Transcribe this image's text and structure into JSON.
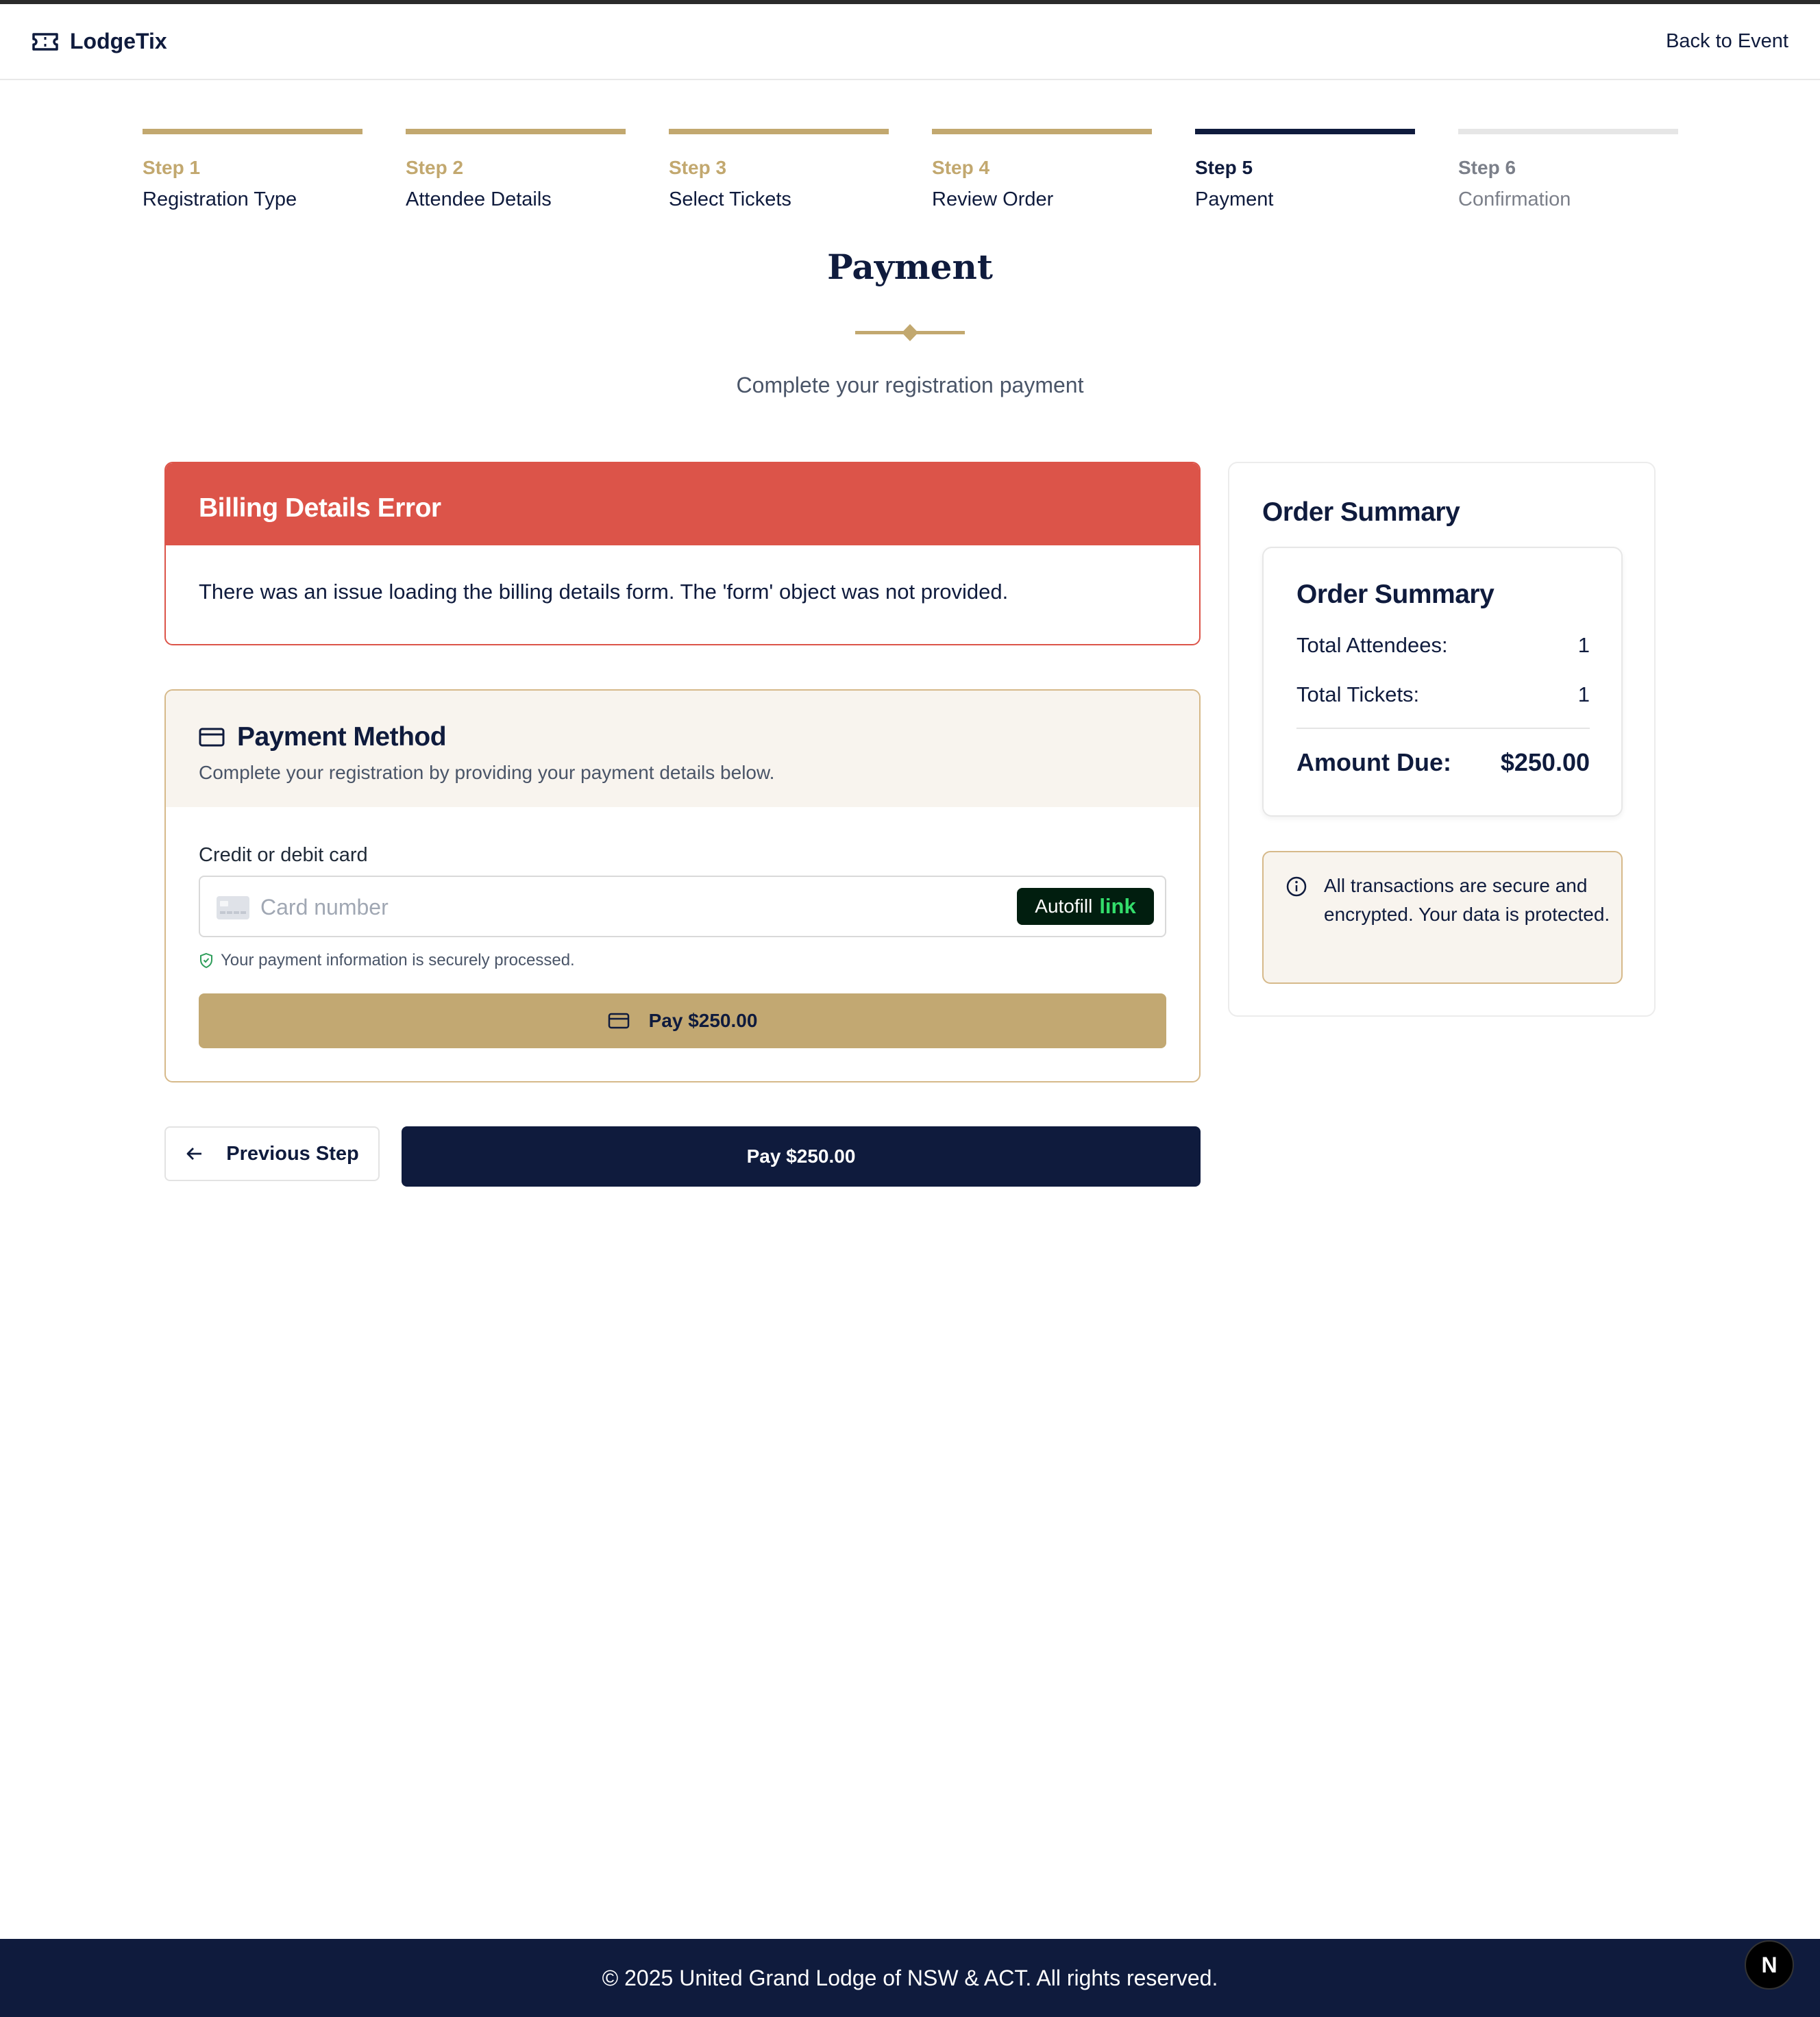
{
  "header": {
    "brand": "LodgeTix",
    "back_link": "Back to Event"
  },
  "steps": [
    {
      "num": "Step 1",
      "name": "Registration Type",
      "state": "complete"
    },
    {
      "num": "Step 2",
      "name": "Attendee Details",
      "state": "complete"
    },
    {
      "num": "Step 3",
      "name": "Select Tickets",
      "state": "complete"
    },
    {
      "num": "Step 4",
      "name": "Review Order",
      "state": "complete"
    },
    {
      "num": "Step 5",
      "name": "Payment",
      "state": "current"
    },
    {
      "num": "Step 6",
      "name": "Confirmation",
      "state": "upcoming"
    }
  ],
  "page": {
    "title": "Payment",
    "subtitle": "Complete your registration payment"
  },
  "error": {
    "title": "Billing Details Error",
    "message": "There was an issue loading the billing details form. The 'form' object was not provided."
  },
  "payment_method": {
    "title": "Payment Method",
    "description": "Complete your registration by providing your payment details below.",
    "card_label": "Credit or debit card",
    "card_placeholder": "Card number",
    "card_value": "",
    "autofill_text": "Autofill",
    "autofill_link": "link",
    "secure_note": "Your payment information is securely processed.",
    "pay_button": "Pay $250.00"
  },
  "navigation": {
    "previous": "Previous Step",
    "pay": "Pay $250.00"
  },
  "summary": {
    "title": "Order Summary",
    "inner_title": "Order Summary",
    "attendees_label": "Total Attendees:",
    "attendees_value": "1",
    "tickets_label": "Total Tickets:",
    "tickets_value": "1",
    "amount_label": "Amount Due:",
    "amount_value": "$250.00",
    "secure_text": "All transactions are secure and encrypted. Your data is protected."
  },
  "footer": {
    "text": "© 2025 United Grand Lodge of NSW & ACT. All rights reserved.",
    "badge": "N"
  },
  "colors": {
    "navy": "#0f1b3d",
    "gold": "#c2a86f",
    "error_red": "#dc5449",
    "cream": "#f8f4ee",
    "link_green": "#33dd6b"
  },
  "icons": {
    "brand": "ticket-icon",
    "payment": "credit-card-icon",
    "secure": "shield-check-icon",
    "info": "info-icon",
    "back": "arrow-left-icon"
  }
}
